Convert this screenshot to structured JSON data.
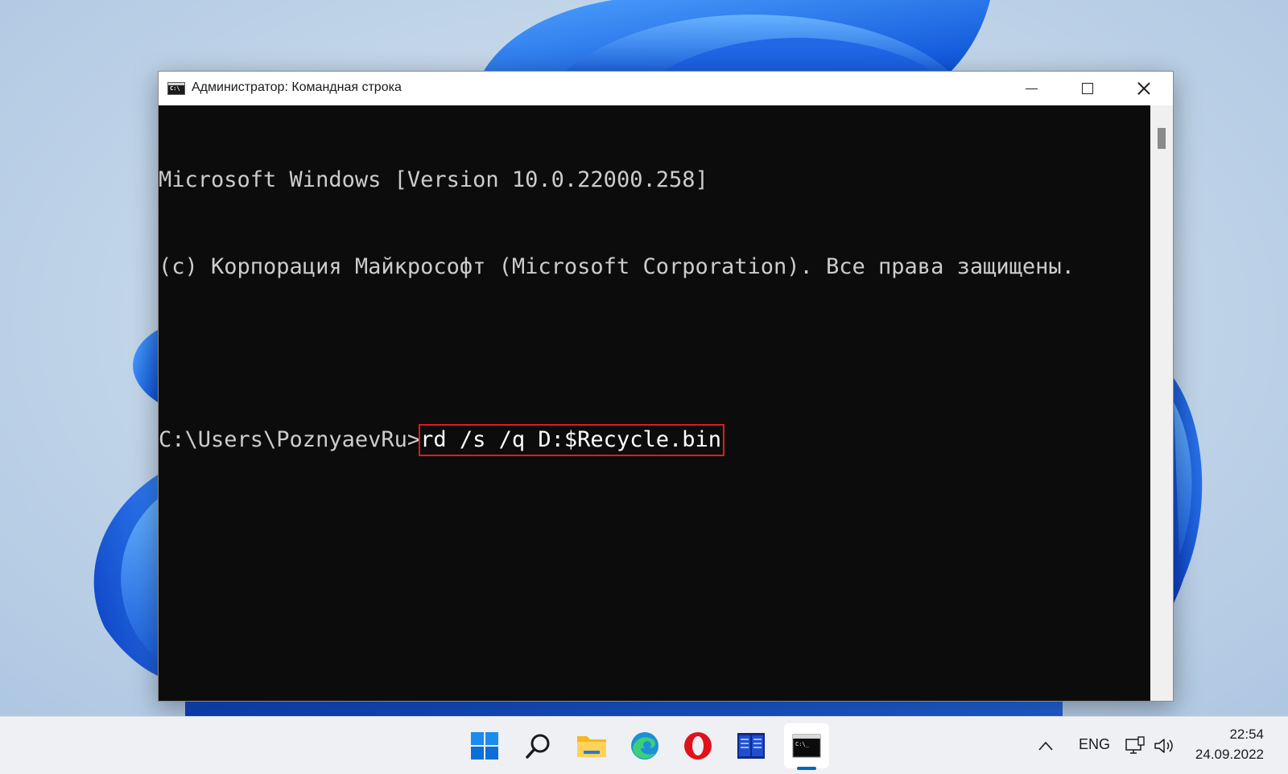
{
  "window": {
    "title": "Администратор: Командная строка"
  },
  "console": {
    "lines": [
      "Microsoft Windows [Version 10.0.22000.258]",
      "(c) Корпорация Майкрософт (Microsoft Corporation). Все права защищены."
    ],
    "prompt": "C:\\Users\\PoznyaevRu>",
    "command": "rd /s /q D:$Recycle.bin",
    "highlight_color": "#e11b1b"
  },
  "taskbar": {
    "icons": [
      "windows-start-icon",
      "search-icon",
      "file-explorer-icon",
      "edge-icon",
      "opera-icon",
      "total-commander-icon",
      "command-prompt-icon"
    ],
    "active": "command-prompt-icon",
    "accent_color": "#0067c0",
    "tray": {
      "language": "ENG",
      "time": "22:54",
      "date": "24.09.2022"
    }
  }
}
